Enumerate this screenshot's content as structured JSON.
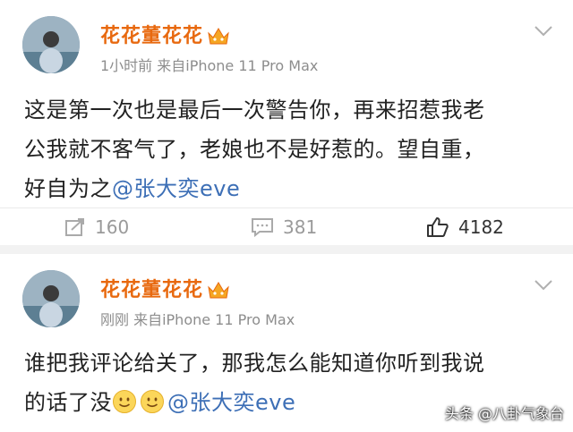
{
  "posts": [
    {
      "username": "花花董花花",
      "meta": "1小时前  来自iPhone 11 Pro Max",
      "lines": [
        "这是第一次也是最后一次警告你，再来招惹我老",
        "公我就不客气了，老娘也不是好惹的。望自重，",
        "好自为之"
      ],
      "mention": "@张大奕eve",
      "actions": {
        "repost": "160",
        "comment": "381",
        "like": "4182"
      }
    },
    {
      "username": "花花董花花",
      "meta": "刚刚  来自iPhone 11 Pro Max",
      "lines": [
        "谁把我评论给关了，那我怎么能知道你听到我说",
        "的话了没"
      ],
      "mention": "@张大奕eve"
    }
  ],
  "watermark": "头条 @八卦气象台",
  "colors": {
    "username": "#e8690f",
    "mention": "#3d6fb6",
    "meta": "#8d8d8d"
  },
  "icons": [
    "vip-crown-icon",
    "chevron-down-icon",
    "repost-icon",
    "comment-icon",
    "like-icon",
    "smile-emoji-icon"
  ]
}
